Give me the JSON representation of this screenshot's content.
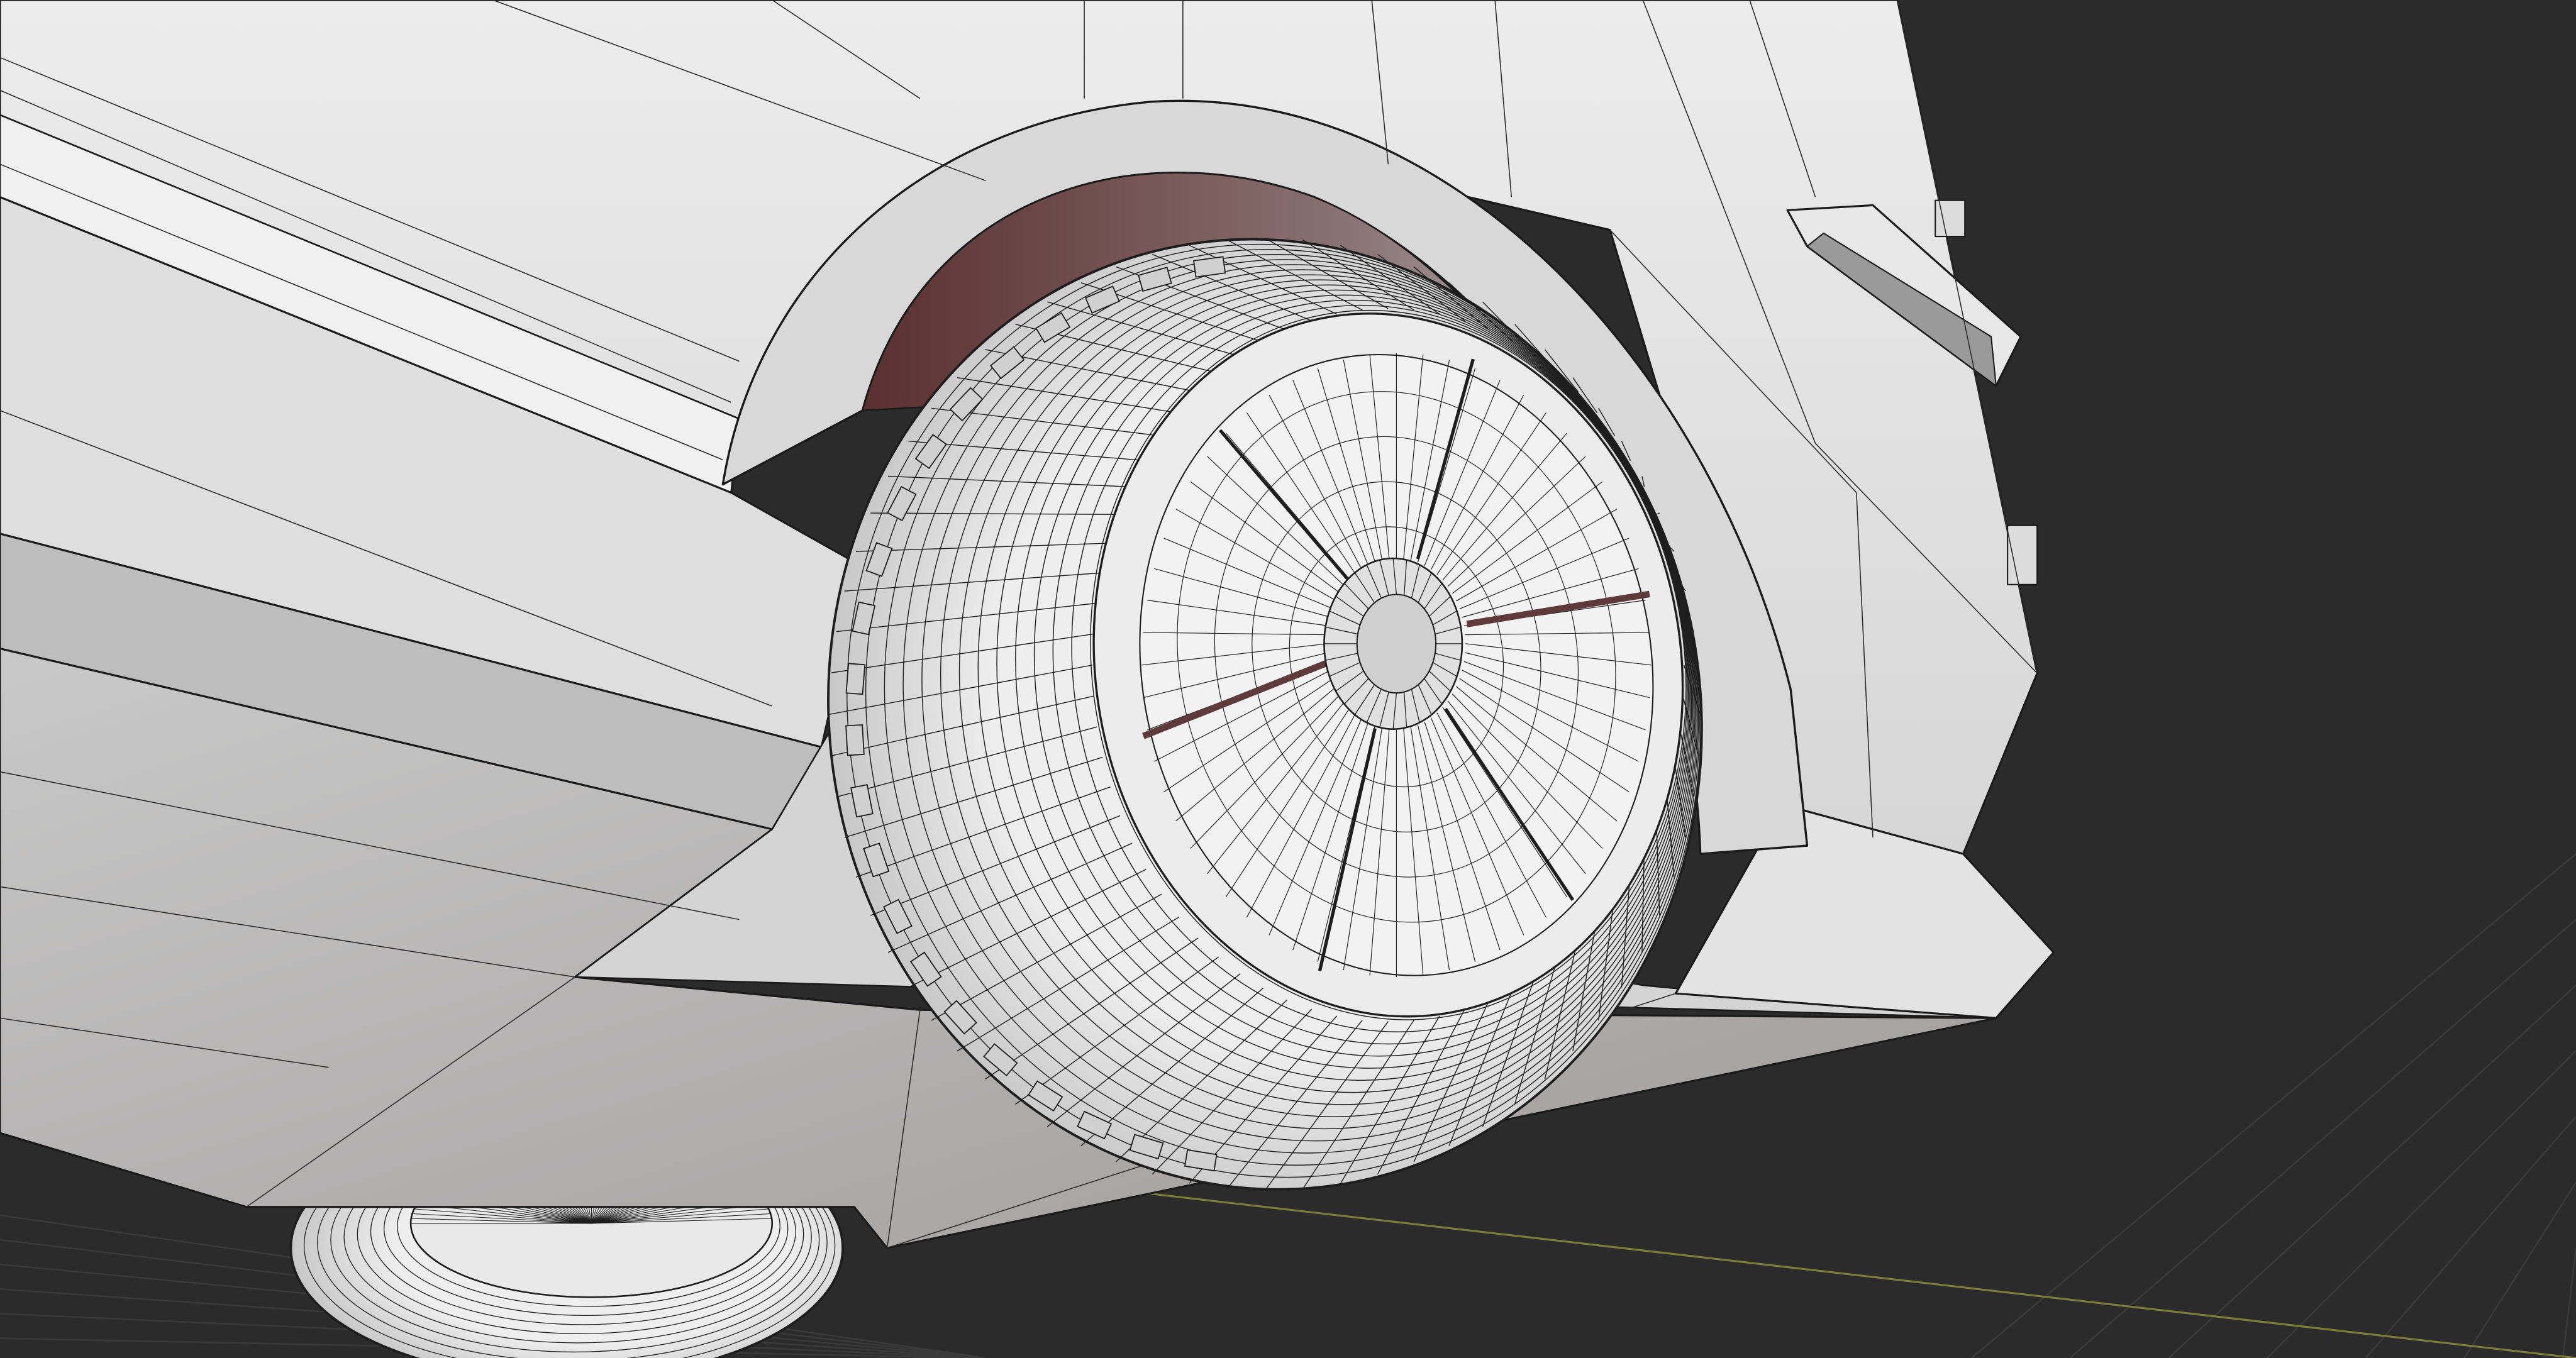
{
  "viewport": {
    "kind": "3d-viewport",
    "shading": "solid-wireframe",
    "colors": {
      "background": "#2b2b2b",
      "grid_line": "#3a3a3a",
      "x_axis": "#8a8a3a",
      "body_light": "#e6e6e6",
      "body_mid": "#cfcfcf",
      "body_shadow": "#a5a2a1",
      "tire": "#e4e4e4",
      "wire": "#1e1e1e",
      "wheel_well": "#6f3a3a"
    }
  },
  "model": {
    "subject": "car-rear-quarter-underside",
    "objects": [
      "car-body",
      "rear-wheel",
      "front-wheel"
    ],
    "wheel_spokes": 6,
    "tread_segments": 72
  }
}
